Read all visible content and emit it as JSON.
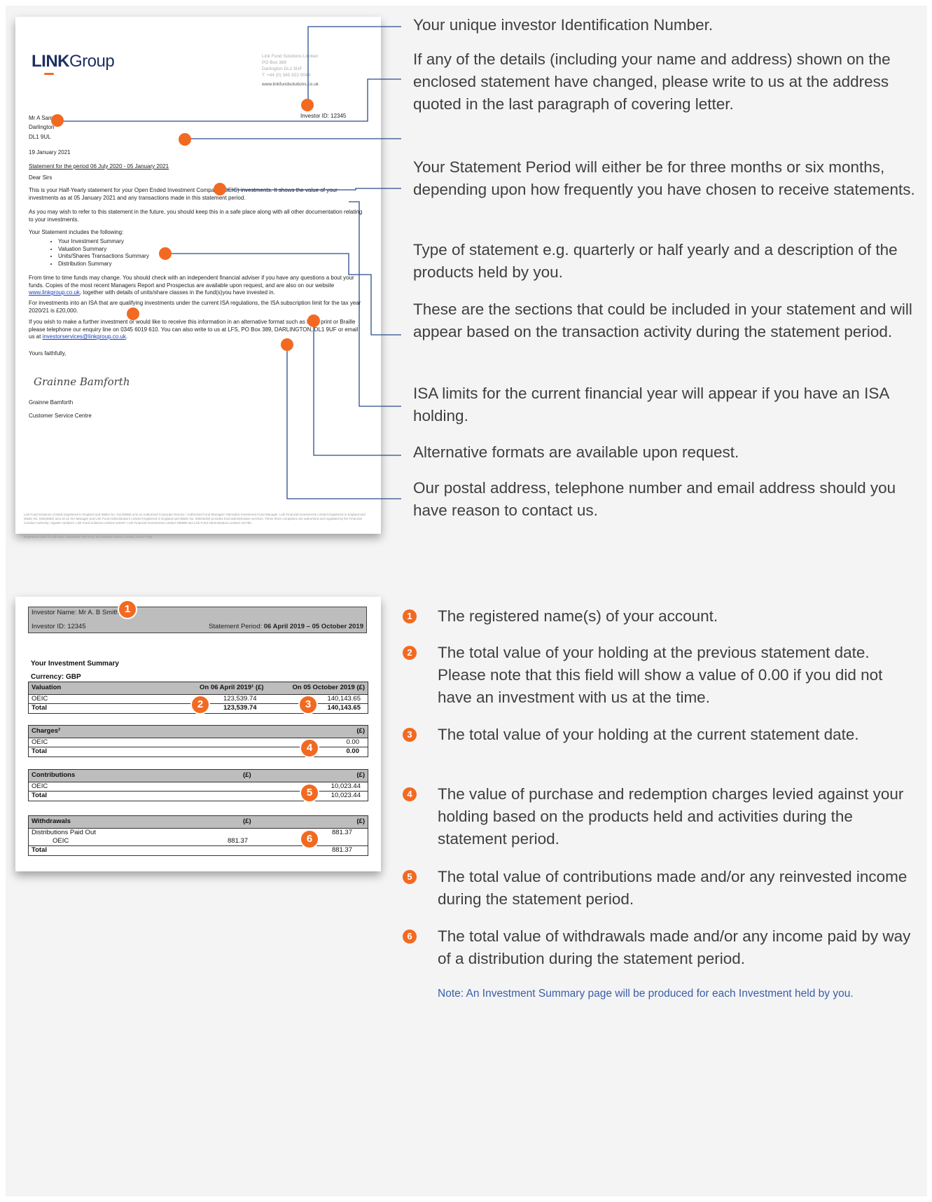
{
  "letter": {
    "logo_bold": "LINK",
    "logo_rest": "Group",
    "company_lines": [
      "Link Fund Solutions Limited",
      "PO Box 389",
      "Darlington DL1 9UF",
      "T: +44 (0) 345 922 0044"
    ],
    "website": "www.linkfundsolutions.co.uk",
    "investor_id": "Investor ID: 12345",
    "addressee": "Mr A Sample",
    "town": "Darlington",
    "postcode": "DL1 9UL",
    "date": "19 January 2021",
    "subject": "Statement for the period 06 July 2020 - 05 January 2021",
    "salutation": "Dear Sirs",
    "para1": "This is your Half-Yearly statement for your Open Ended Investment Company (OEIC) investments. It shows the value of your investments as at 05 January 2021 and any transactions made in this statement period.",
    "para2": "As you may wish to refer to this statement in the future, you should keep this in a safe place along with all other documentation relating to your investments.",
    "includes_intro": "Your Statement includes the following:",
    "includes": [
      "Your Investment Summary",
      "Valuation Summary",
      "Units/Shares Transactions Summary",
      "Distribution Summary"
    ],
    "para3_a": "From time to time funds may change. You should check with an independent financial adviser if you have any questions a bout your funds. Copies of the most recent Managers Report and Prospectus are available upon request, and are also on our website ",
    "para3_link": "www.linkgroup.co.uk",
    "para3_b": ", together with details of units/share classes in the fund(s)you have invested in.",
    "para4": "For investments into an ISA that are qualifying investments under the current ISA regulations, the ISA subscription limit for the tax year 2020/21 is £20,000.",
    "para5_a": "If you wish to make a further investment or would like to receive this information in an alternative format such as large print or Braille please telephone our enquiry line on 0345 6019 610. You can also write to us at LFS, PO Box 389, DARLINGTON, DL1 9UF or email us at ",
    "para5_link": "investorservices@linkgroup.co.uk",
    "para5_b": ".",
    "closing": "Yours faithfully,",
    "signature": "Grainne Bamforth",
    "signer_name": "Grainne Bamforth",
    "signer_dept": "Customer Service Centre",
    "footer_legal": "Link Fund Solutions Limited (registered in England and Wales No. 01146988) acts as Authorised Corporate Director / Authorised Fund Manager/ Alternative Investment Fund Manager. Link Financial Investments Limited (registered in England and Wales No. 02823682) acts as an ISA Manager and Link Fund Administrators Limited (registered in England and Wales No. 00504528) provides fund administration services. These three companies are authorised and regulated by the Financial Conduct Authority; register numbers: Link Fund Solutions Limited 119197; Link Financial Investments Limited 168588 and Link Fund Administrators Limited 121790.",
    "footer_reg": "Registered office for all three companies: 6th Floor, 65 Gresham Street, London, EC2V 7NQ"
  },
  "callouts": [
    "Your unique investor Identification Number.",
    "If any of the details (including your name and address) shown on the enclosed statement have changed, please write to us at the address quoted in the last paragraph of covering letter.",
    "Your Statement Period will either be for three months or six months, depending upon how frequently you have chosen to receive statements.",
    "Type of statement e.g. quarterly or half yearly and a description of the products held by you.",
    "These are the sections that could be included in your statement and will appear based on the transaction activity during the statement period.",
    "ISA limits for the current financial year will appear if you have an ISA holding.",
    "Alternative formats are available upon request.",
    "Our postal address, telephone number and email address should you have reason to contact us."
  ],
  "summary": {
    "investor_name": "Investor Name: Mr A. B Smith",
    "investor_id": "Investor ID: 12345",
    "period_label": "Statement Period: ",
    "period_value": "06 April 2019 – 05 October 2019",
    "title": "Your Investment Summary",
    "currency": "Currency: GBP",
    "valuation": {
      "h1": "Valuation",
      "h2": "On 06 April 2019¹ (£)",
      "h3": "On 05 October 2019 (£)",
      "r1": [
        "OEIC",
        "123,539.74",
        "140,143.65"
      ],
      "r2": [
        "Total",
        "123,539.74",
        "140,143.65"
      ]
    },
    "charges": {
      "h1": "Charges²",
      "h3": "(£)",
      "r1": [
        "OEIC",
        "0.00"
      ],
      "r2": [
        "Total",
        "0.00"
      ]
    },
    "contributions": {
      "h1": "Contributions",
      "h2": "(£)",
      "h3": "(£)",
      "r1": [
        "OEIC",
        "10,023.44"
      ],
      "r2": [
        "Total",
        "10,023.44"
      ]
    },
    "withdrawals": {
      "h1": "Withdrawals",
      "h2": "(£)",
      "h3": "(£)",
      "r1": [
        "Distributions Paid Out",
        "881.37"
      ],
      "r2": [
        "OEIC",
        "881.37"
      ],
      "r3": [
        "Total",
        "881.37"
      ]
    },
    "badges": [
      "1",
      "2",
      "3",
      "4",
      "5",
      "6"
    ]
  },
  "numbered": [
    {
      "n": "1",
      "text": "The registered name(s) of your account."
    },
    {
      "n": "2",
      "text": "The total value of your holding at the previous statement date. Please note that this field will show a value of 0.00 if you did not have an investment with us at the time."
    },
    {
      "n": "3",
      "text": "The total value of your holding at the current statement date."
    },
    {
      "n": "4",
      "text": "The value of purchase and redemption charges levied against your holding based on the products held and activities during the statement period."
    },
    {
      "n": "5",
      "text": "The total value of contributions made and/or any reinvested income during the statement period."
    },
    {
      "n": "6",
      "text": "The total value of withdrawals made and/or any income paid by way of a distribution during the statement period."
    }
  ],
  "note": "Note: An Investment Summary page will be produced for each Investment held by you.",
  "colors": {
    "accent": "#f26a21",
    "line": "#2b4c8c",
    "note": "#3a5ea6",
    "brand": "#1d2f63"
  }
}
